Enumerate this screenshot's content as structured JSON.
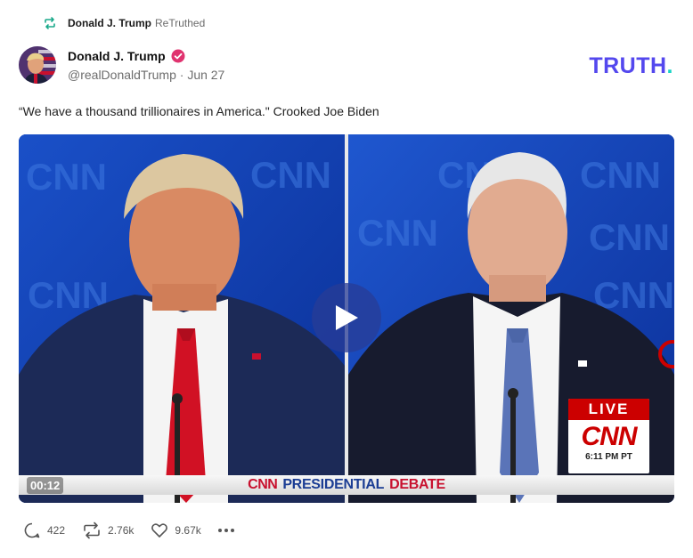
{
  "retruth": {
    "user": "Donald J. Trump",
    "verb": "ReTruthed"
  },
  "post": {
    "display_name": "Donald J. Trump",
    "handle": "@realDonaldTrump",
    "separator": "·",
    "date": "Jun 27",
    "text": "“We have a thousand trillionaires in America.\" Crooked Joe Biden"
  },
  "brand": {
    "logo_text": "TRUTH",
    "logo_dot": ".",
    "color": "#5448ee",
    "dot_color": "#17d4c5"
  },
  "video": {
    "timecode": "00:12",
    "chyron_network": "CNN",
    "chyron_title_1": "PRESIDENTIAL",
    "chyron_title_2": "DEBATE",
    "live_label": "LIVE",
    "live_network": "CNN",
    "live_time": "6:11 PM PT",
    "background_network_text": "CNN"
  },
  "actions": {
    "replies": "422",
    "retruths": "2.76k",
    "likes": "9.67k"
  },
  "icons": {
    "retruth": "retruth-icon",
    "verified": "verified-badge-icon",
    "reply": "reply-icon",
    "like": "heart-icon",
    "more": "more-icon",
    "play": "play-icon"
  }
}
